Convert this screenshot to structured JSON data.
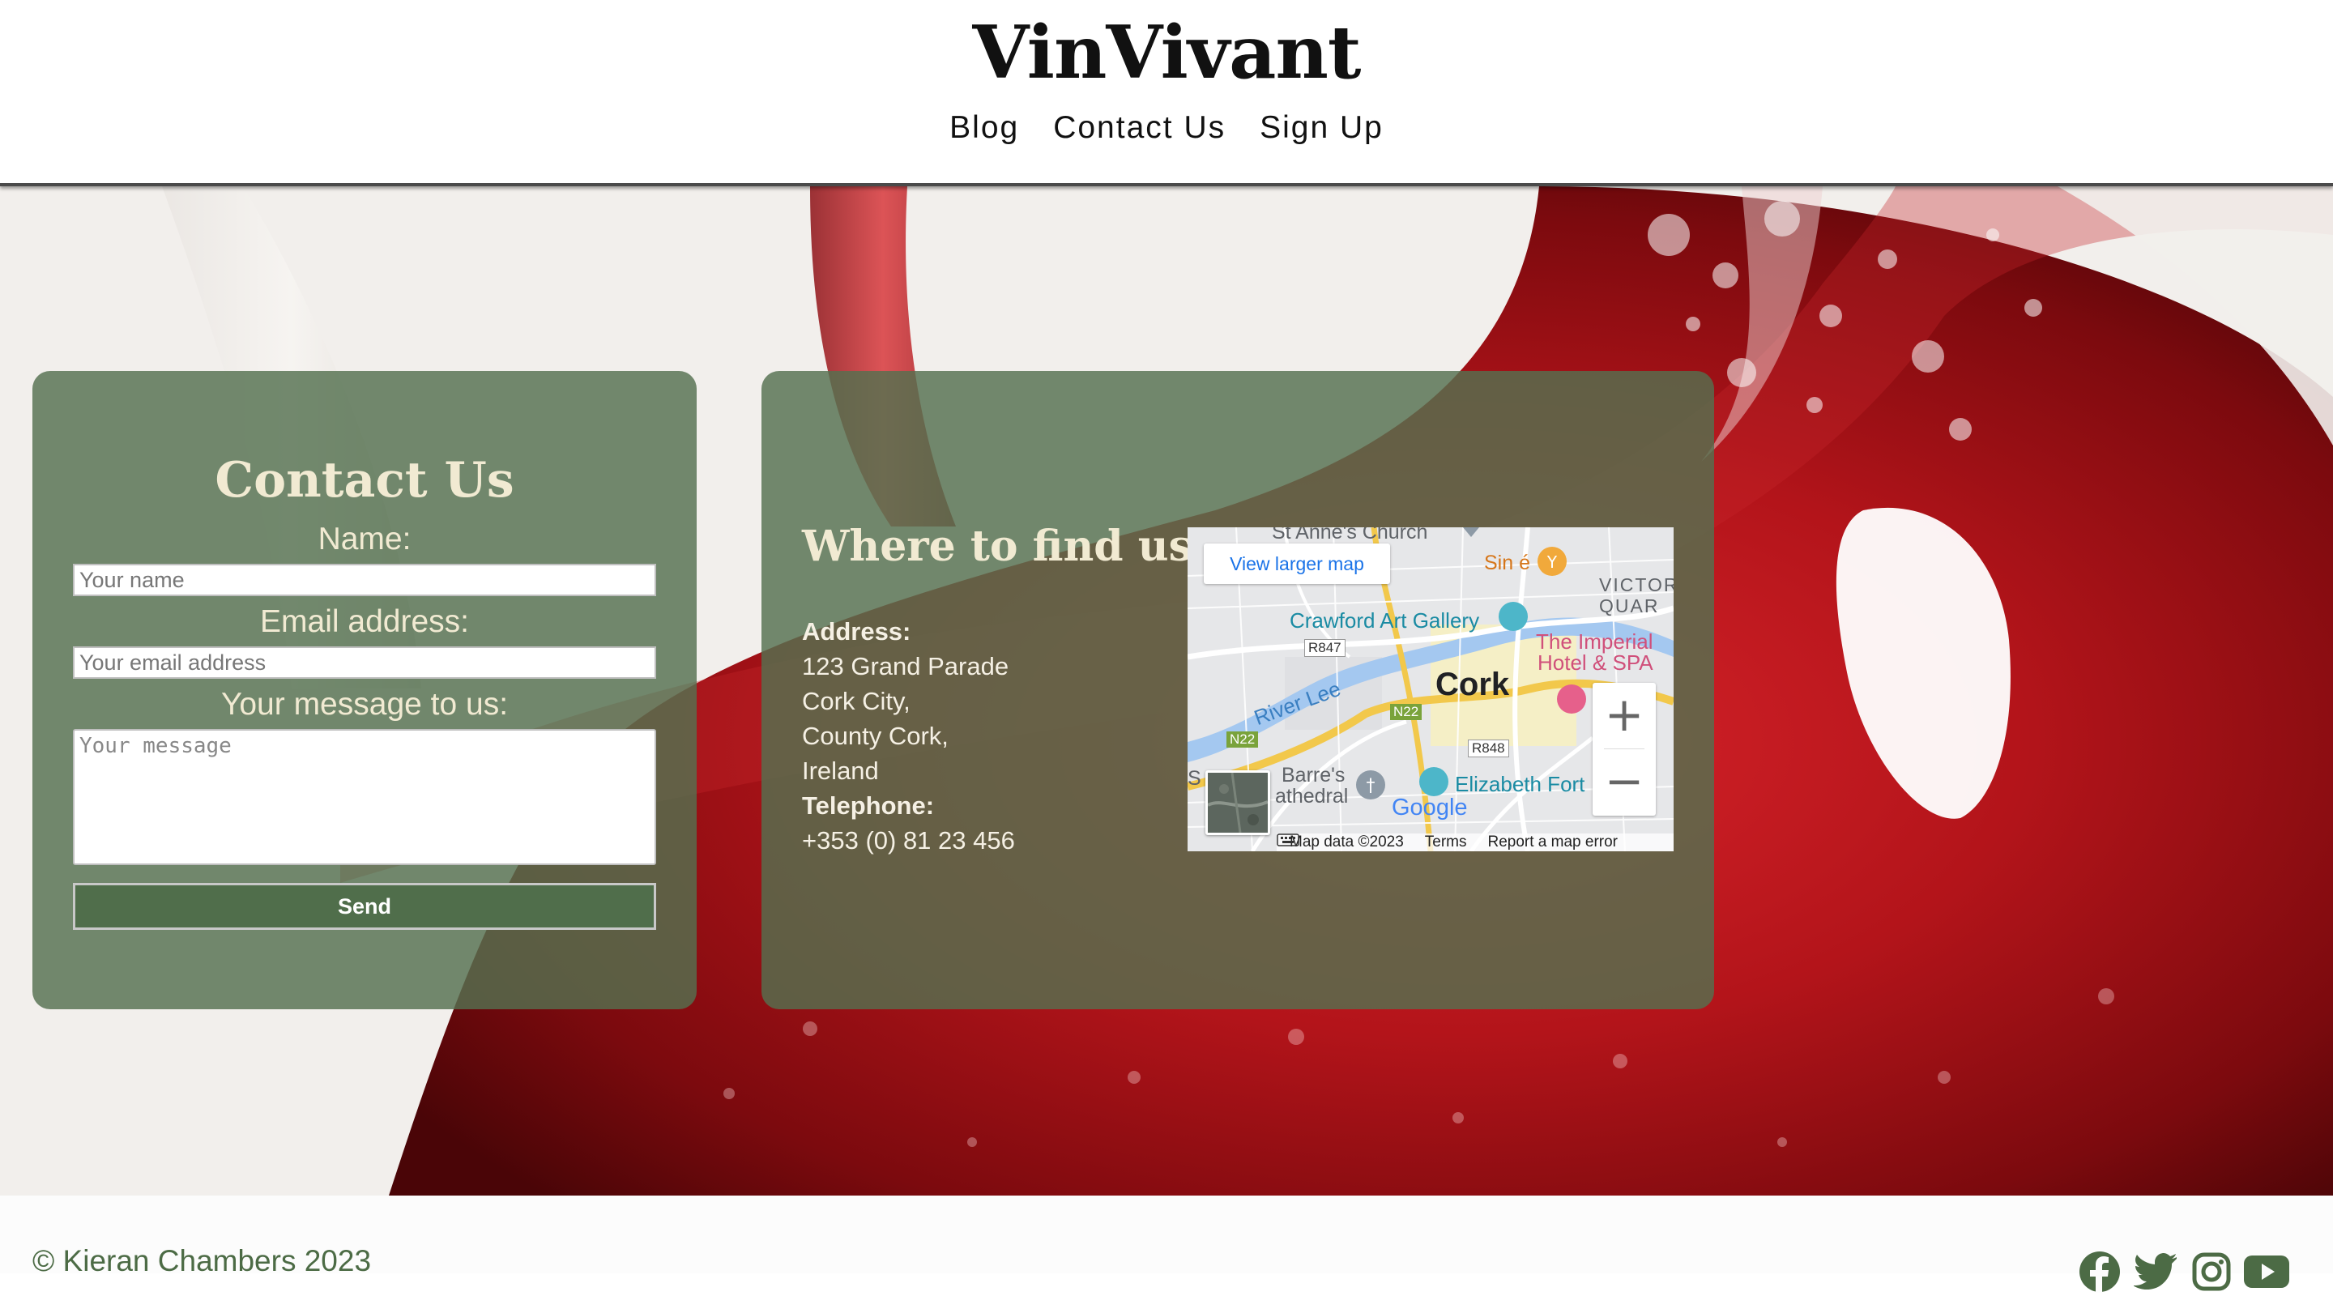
{
  "header": {
    "brand": "VinVivant",
    "nav": [
      "Blog",
      "Contact Us",
      "Sign Up"
    ]
  },
  "contact_form": {
    "title": "Contact Us",
    "name_label": "Name:",
    "name_placeholder": "Your name",
    "email_label": "Email address:",
    "email_placeholder": "Your email address",
    "message_label": "Your message to us:",
    "message_placeholder": "Your message",
    "send_label": "Send"
  },
  "find_us": {
    "title": "Where to find us",
    "address_label": "Address:",
    "address_lines": [
      "123 Grand Parade",
      "Cork City,",
      "County Cork,",
      "Ireland"
    ],
    "telephone_label": "Telephone:",
    "telephone": "+353 (0) 81 23 456"
  },
  "map": {
    "view_larger": "View larger map",
    "zoom_in": "+",
    "zoom_out": "−",
    "places": {
      "church": "St Anne's Church",
      "sine": "Sin é",
      "victoria": "VICTOR",
      "quarter": "QUAR",
      "gallery": "Crawford Art Gallery",
      "hotel1": "The Imperial",
      "hotel2": "Hotel & SPA",
      "road_r847": "R847",
      "road_n22a": "N22",
      "road_n22b": "N22",
      "road_r848": "R848",
      "river": "River Lee",
      "city": "Cork",
      "cathedral1": "Barre's",
      "cathedral2": "athedral",
      "s_prefix": "S",
      "fort": "Elizabeth Fort",
      "google": "Google"
    },
    "attribution": "Map data ©2023",
    "terms": "Terms",
    "report": "Report a map error"
  },
  "footer": {
    "copyright": "© Kieran Chambers 2023"
  },
  "colors": {
    "panel": "#54704f",
    "heading": "#f1ead2",
    "footer_text": "#4c6b45",
    "wine": "#b3141a"
  },
  "icons": [
    "facebook-icon",
    "twitter-icon",
    "instagram-icon",
    "youtube-icon"
  ]
}
